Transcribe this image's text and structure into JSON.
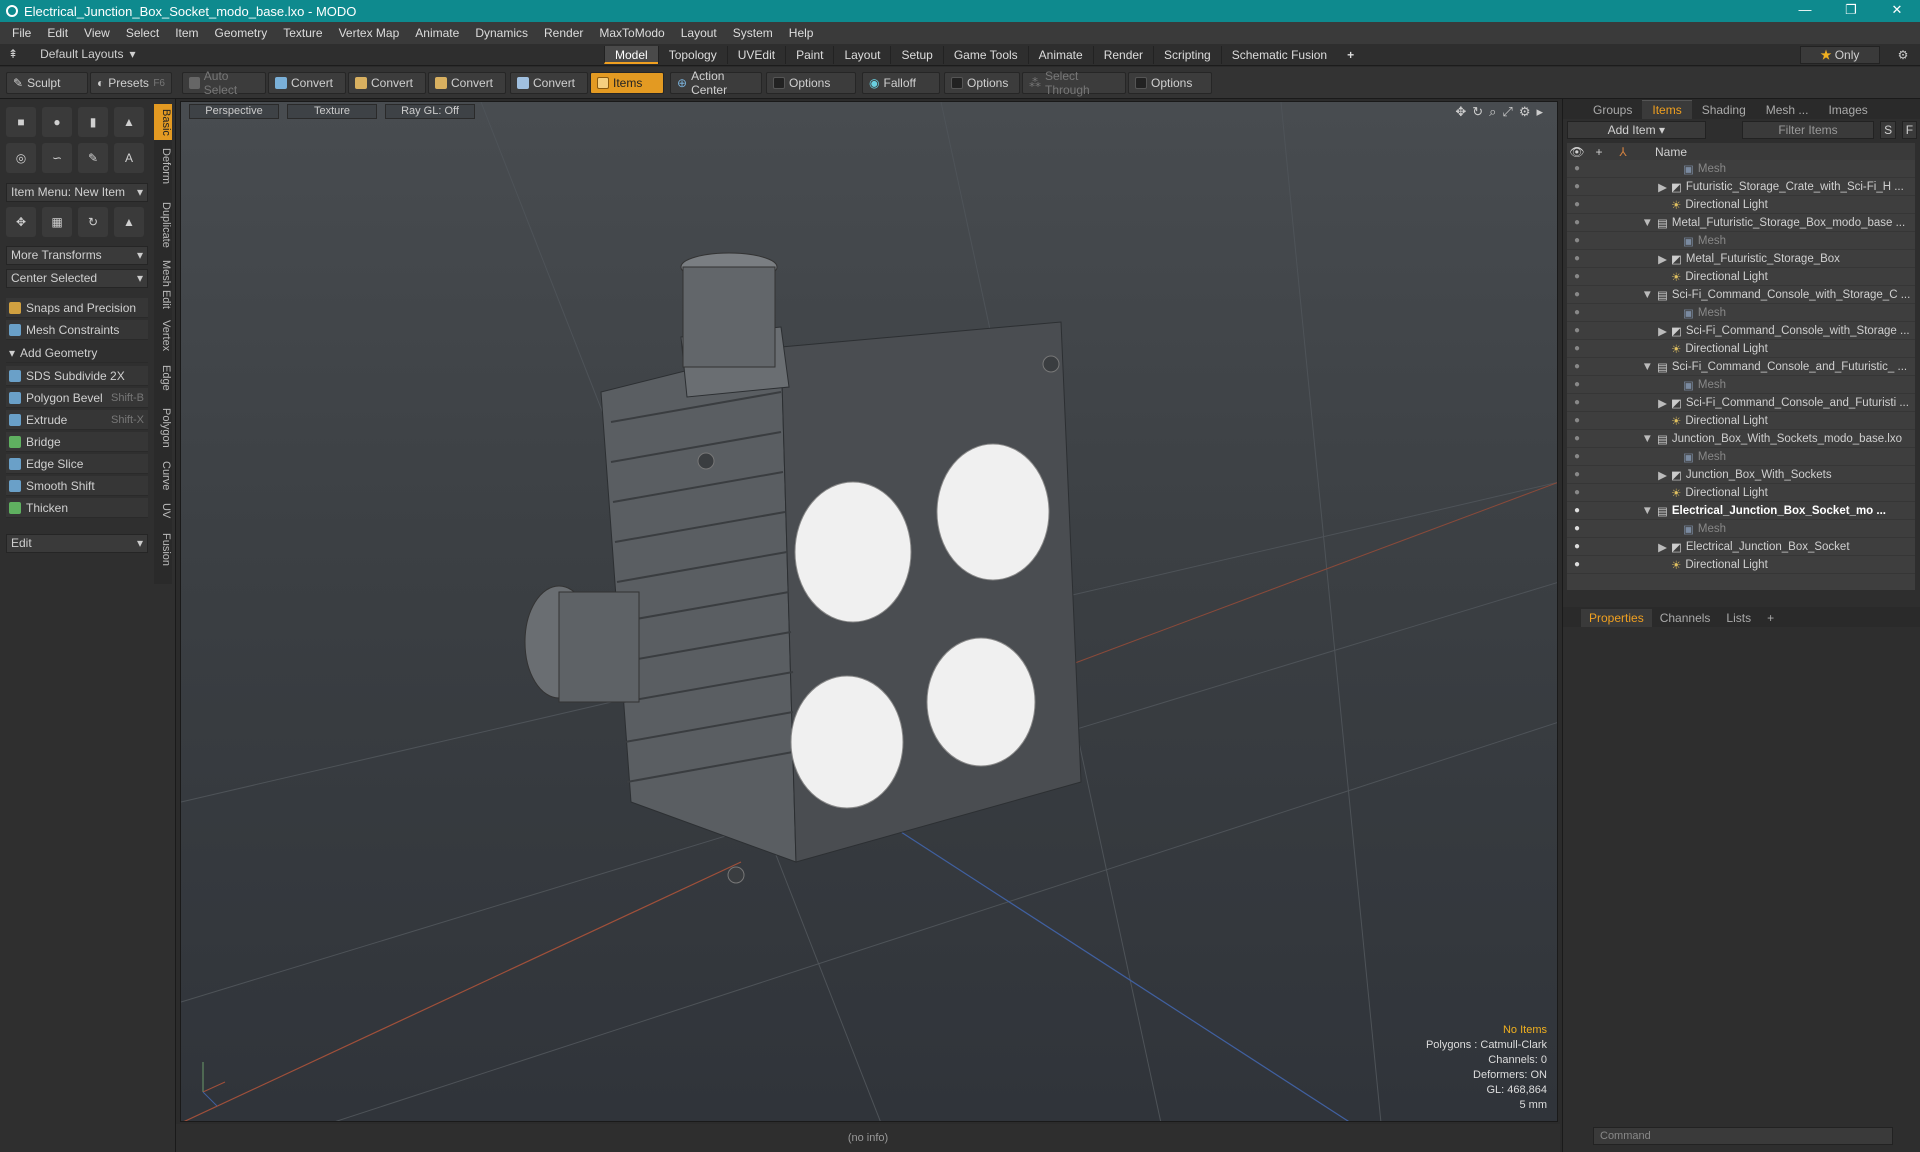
{
  "window": {
    "title": "Electrical_Junction_Box_Socket_modo_base.lxo - MODO",
    "controls": [
      "—",
      "❐",
      "✕"
    ]
  },
  "menu": [
    "File",
    "Edit",
    "View",
    "Select",
    "Item",
    "Geometry",
    "Texture",
    "Vertex Map",
    "Animate",
    "Dynamics",
    "Render",
    "MaxToModo",
    "Layout",
    "System",
    "Help"
  ],
  "layouts": {
    "label": "Default Layouts",
    "tabs": [
      "Model",
      "Topology",
      "UVEdit",
      "Paint",
      "Layout",
      "Setup",
      "Game Tools",
      "Animate",
      "Render",
      "Scripting",
      "Schematic Fusion"
    ],
    "active": "Model",
    "only": "Only"
  },
  "toolbar": {
    "sculpt": "Sculpt",
    "presets": "Presets",
    "presets_key": "F6",
    "auto_select": "Auto Select",
    "convert": "Convert",
    "items": "Items",
    "action_center": "Action Center",
    "options": "Options",
    "falloff": "Falloff",
    "select_through": "Select Through"
  },
  "left": {
    "vtabs": [
      "Basic",
      "Deform",
      "Duplicate",
      "Mesh Edit",
      "Vertex",
      "Edge",
      "Polygon",
      "Curve",
      "UV",
      "Fusion"
    ],
    "item_menu": "Item Menu: New Item",
    "more_transforms": "More Transforms",
    "center_selected": "Center Selected",
    "snaps": "Snaps and Precision",
    "mesh_constraints": "Mesh Constraints",
    "add_geometry": "Add Geometry",
    "tools": [
      {
        "label": "SDS Subdivide 2X",
        "key": ""
      },
      {
        "label": "Polygon Bevel",
        "key": "Shift-B"
      },
      {
        "label": "Extrude",
        "key": "Shift-X"
      },
      {
        "label": "Bridge",
        "key": ""
      },
      {
        "label": "Edge Slice",
        "key": ""
      },
      {
        "label": "Smooth Shift",
        "key": ""
      },
      {
        "label": "Thicken",
        "key": ""
      }
    ],
    "edit": "Edit"
  },
  "viewport": {
    "view": "Perspective",
    "shading": "Texture",
    "raygl": "Ray GL: Off",
    "info": {
      "items": "No Items",
      "polygons": "Polygons : Catmull-Clark",
      "channels": "Channels: 0",
      "deformers": "Deformers: ON",
      "gl": "GL: 468,864",
      "scale": "5 mm"
    }
  },
  "status": "(no info)",
  "right": {
    "tabs": [
      "Groups",
      "Items",
      "Shading",
      "Mesh ...",
      "Images"
    ],
    "active_tab": "Items",
    "add_item": "Add Item",
    "filter": "Filter Items",
    "col_name": "Name",
    "s": "S",
    "f": "F",
    "rows": [
      {
        "label": "Mesh",
        "indent": 3,
        "kind": "mesh"
      },
      {
        "label": "Futuristic_Storage_Crate_with_Sci-Fi_H ...",
        "indent": 2,
        "kind": "group"
      },
      {
        "label": "Directional Light",
        "indent": 2,
        "kind": "light"
      },
      {
        "label": "Metal_Futuristic_Storage_Box_modo_base ...",
        "indent": 1,
        "kind": "scene"
      },
      {
        "label": "Mesh",
        "indent": 3,
        "kind": "mesh"
      },
      {
        "label": "Metal_Futuristic_Storage_Box",
        "indent": 2,
        "kind": "group"
      },
      {
        "label": "Directional Light",
        "indent": 2,
        "kind": "light"
      },
      {
        "label": "Sci-Fi_Command_Console_with_Storage_C ...",
        "indent": 1,
        "kind": "scene"
      },
      {
        "label": "Mesh",
        "indent": 3,
        "kind": "mesh"
      },
      {
        "label": "Sci-Fi_Command_Console_with_Storage ...",
        "indent": 2,
        "kind": "group"
      },
      {
        "label": "Directional Light",
        "indent": 2,
        "kind": "light"
      },
      {
        "label": "Sci-Fi_Command_Console_and_Futuristic_ ...",
        "indent": 1,
        "kind": "scene"
      },
      {
        "label": "Mesh",
        "indent": 3,
        "kind": "mesh"
      },
      {
        "label": "Sci-Fi_Command_Console_and_Futuristi ...",
        "indent": 2,
        "kind": "group"
      },
      {
        "label": "Directional Light",
        "indent": 2,
        "kind": "light"
      },
      {
        "label": "Junction_Box_With_Sockets_modo_base.lxo",
        "indent": 1,
        "kind": "scene"
      },
      {
        "label": "Mesh",
        "indent": 3,
        "kind": "mesh"
      },
      {
        "label": "Junction_Box_With_Sockets",
        "indent": 2,
        "kind": "group"
      },
      {
        "label": "Directional Light",
        "indent": 2,
        "kind": "light"
      },
      {
        "label": "Electrical_Junction_Box_Socket_mo ...",
        "indent": 1,
        "kind": "scene-active"
      },
      {
        "label": "Mesh",
        "indent": 3,
        "kind": "mesh-active"
      },
      {
        "label": "Electrical_Junction_Box_Socket",
        "indent": 2,
        "kind": "group-active"
      },
      {
        "label": "Directional Light",
        "indent": 2,
        "kind": "light-active"
      }
    ],
    "prop_tabs": [
      "Properties",
      "Channels",
      "Lists"
    ],
    "command": "Command"
  }
}
